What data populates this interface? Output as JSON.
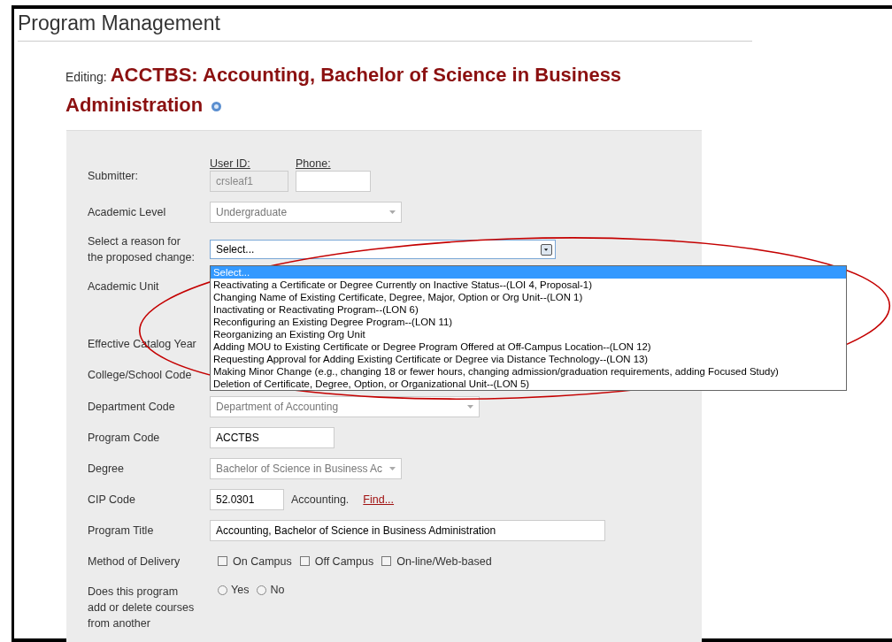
{
  "header": {
    "title": "Program Management"
  },
  "editing": {
    "label": "Editing:",
    "title_lines": [
      "ACCTBS: Accounting, Bachelor of Science in Business",
      "Administration"
    ]
  },
  "form": {
    "rows": [
      {
        "kind": "submitter",
        "label": "Submitter:",
        "user_id_label": "User ID:",
        "user_id": "crsleaf1",
        "phone_label": "Phone:"
      },
      {
        "kind": "select",
        "label": "Academic Level",
        "value": "Undergraduate",
        "disabled": true
      },
      {
        "kind": "open_select",
        "label": "Select a reason for the proposed change:",
        "value": "Select...",
        "options": [
          {
            "text": "Select...",
            "selected": true
          },
          {
            "text": "Reactivating a Certificate or Degree Currently on Inactive Status--(LOI 4, Proposal-1)",
            "selected": false
          },
          {
            "text": "Changing Name of Existing Certificate, Degree, Major, Option or Org Unit--(LON 1)",
            "selected": false
          },
          {
            "text": "Inactivating or Reactivating Program--(LON 6)",
            "selected": false
          },
          {
            "text": "Reconfiguring an Existing Degree Program--(LON 11)",
            "selected": false
          },
          {
            "text": "Reorganizing an Existing Org Unit",
            "selected": false
          },
          {
            "text": "Adding MOU to Existing Certificate or Degree Program Offered at Off-Campus Location--(LON 12)",
            "selected": false
          },
          {
            "text": "Requesting Approval for Adding Existing Certificate or Degree via Distance Technology--(LON 13)",
            "selected": false
          },
          {
            "text": "Making Minor Change (e.g., changing 18 or fewer hours, changing admission/graduation requirements, adding Focused Study)",
            "selected": false
          },
          {
            "text": "Deletion of Certificate, Degree, Option, or Organizational Unit--(LON 5)",
            "selected": false
          }
        ]
      },
      {
        "kind": "blank",
        "label": "Academic Unit"
      },
      {
        "kind": "blank",
        "label": "Effective Catalog Year"
      },
      {
        "kind": "blank",
        "label": "College/School Code"
      },
      {
        "kind": "select",
        "label": "Department Code",
        "value": "Department of Accounting",
        "disabled": true
      },
      {
        "kind": "text",
        "label": "Program Code",
        "value": "ACCTBS"
      },
      {
        "kind": "select",
        "label": "Degree",
        "value": "Bachelor of Science in Business Ac",
        "disabled": true
      },
      {
        "kind": "cip",
        "label": "CIP Code",
        "value": "52.0301",
        "description": "Accounting.",
        "link": "Find..."
      },
      {
        "kind": "text",
        "label": "Program Title",
        "value": "Accounting, Bachelor of Science in Business Administration"
      },
      {
        "kind": "checkboxes",
        "label": "Method of Delivery",
        "options": [
          {
            "text": "On Campus",
            "checked": false
          },
          {
            "text": "Off Campus",
            "checked": false
          },
          {
            "text": "On-line/Web-based",
            "checked": false
          }
        ]
      },
      {
        "kind": "radios",
        "label": "Does this program add or delete courses from another",
        "options": [
          {
            "text": "Yes",
            "selected": false
          },
          {
            "text": "No",
            "selected": false
          }
        ]
      }
    ]
  }
}
